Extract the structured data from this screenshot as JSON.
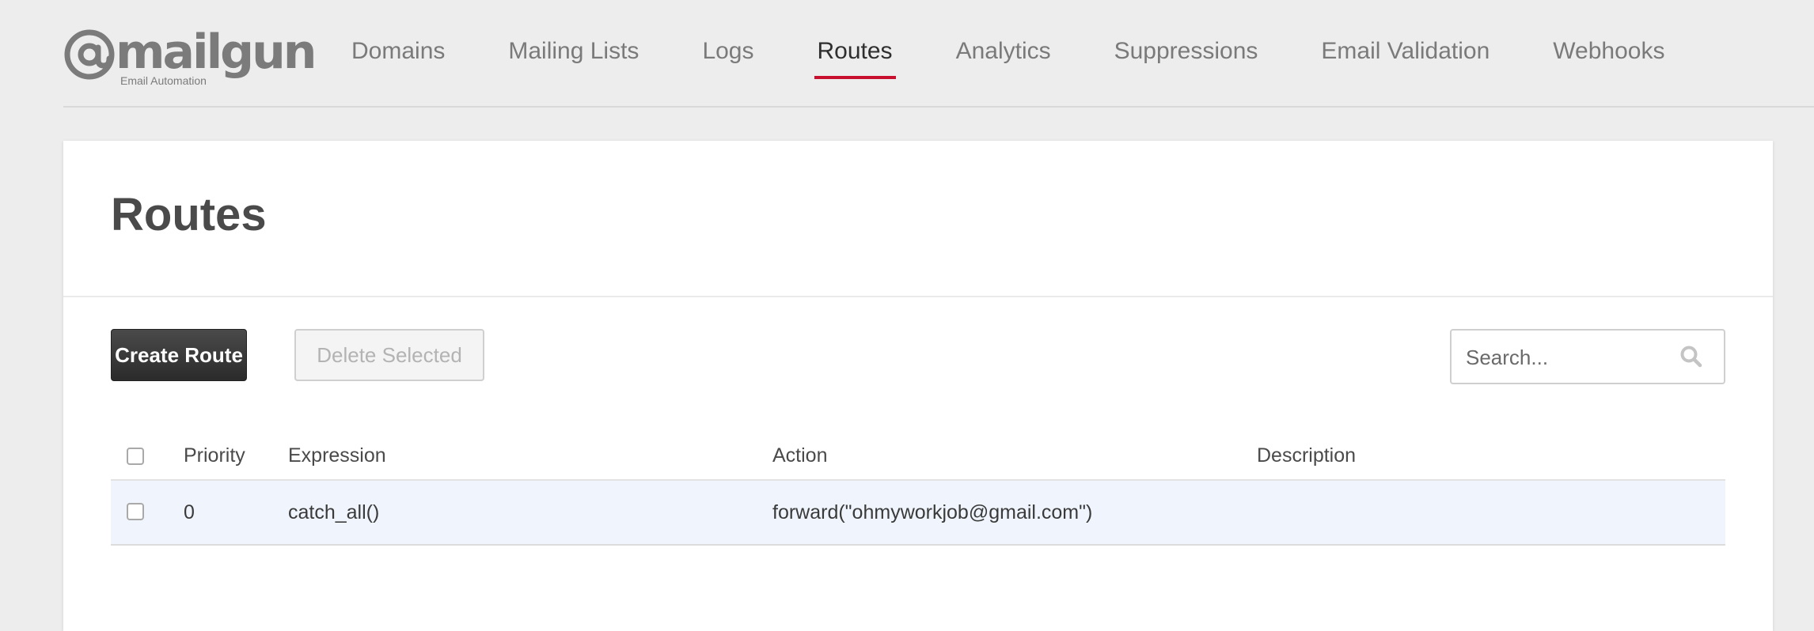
{
  "brand": {
    "name": "mailgun",
    "tagline": "Email Automation",
    "accent_color": "#c8102e",
    "logo_icon": "at-sign-icon"
  },
  "nav": {
    "items": [
      {
        "label": "Domains"
      },
      {
        "label": "Mailing Lists"
      },
      {
        "label": "Logs"
      },
      {
        "label": "Routes",
        "active": true
      },
      {
        "label": "Analytics"
      },
      {
        "label": "Suppressions"
      },
      {
        "label": "Email Validation"
      },
      {
        "label": "Webhooks"
      }
    ]
  },
  "page": {
    "title": "Routes"
  },
  "toolbar": {
    "create_label": "Create Route",
    "delete_label": "Delete Selected"
  },
  "search": {
    "placeholder": "Search...",
    "icon": "search-icon"
  },
  "table": {
    "columns": [
      "Priority",
      "Expression",
      "Action",
      "Description"
    ],
    "rows": [
      {
        "priority": "0",
        "expression": "catch_all()",
        "action": "forward(\"ohmyworkjob@gmail.com\")",
        "description": ""
      }
    ]
  }
}
